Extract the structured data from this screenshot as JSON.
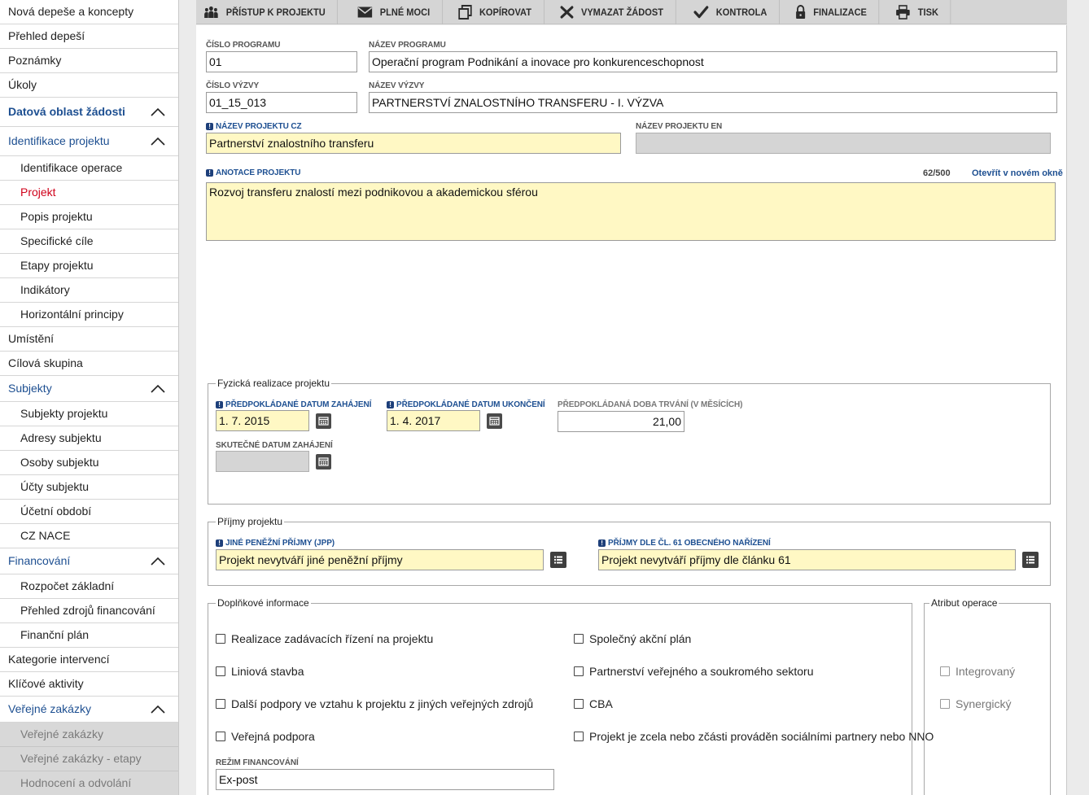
{
  "sidebar": {
    "items": [
      {
        "label": "Nová depeše a koncepty"
      },
      {
        "label": "Přehled depeší"
      },
      {
        "label": "Poznámky"
      },
      {
        "label": "Úkoly"
      },
      {
        "label": "Datová oblast žádosti"
      },
      {
        "label": "Identifikace projektu"
      },
      {
        "label": "Identifikace operace"
      },
      {
        "label": "Projekt"
      },
      {
        "label": "Popis projektu"
      },
      {
        "label": "Specifické cíle"
      },
      {
        "label": "Etapy projektu"
      },
      {
        "label": "Indikátory"
      },
      {
        "label": "Horizontální principy"
      },
      {
        "label": "Umístění"
      },
      {
        "label": "Cílová skupina"
      },
      {
        "label": "Subjekty"
      },
      {
        "label": "Subjekty projektu"
      },
      {
        "label": "Adresy subjektu"
      },
      {
        "label": "Osoby subjektu"
      },
      {
        "label": "Účty subjektu"
      },
      {
        "label": "Účetní období"
      },
      {
        "label": "CZ NACE"
      },
      {
        "label": "Financování"
      },
      {
        "label": "Rozpočet základní"
      },
      {
        "label": "Přehled zdrojů financování"
      },
      {
        "label": "Finanční plán"
      },
      {
        "label": "Kategorie intervencí"
      },
      {
        "label": "Klíčové aktivity"
      },
      {
        "label": "Veřejné zakázky"
      },
      {
        "label": "Veřejné zakázky"
      },
      {
        "label": "Veřejné zakázky - etapy"
      },
      {
        "label": "Hodnocení a odvolání"
      }
    ]
  },
  "toolbar": {
    "buttons": [
      {
        "label": "PŘÍSTUP K PROJEKTU",
        "icon": "users-icon"
      },
      {
        "label": "PLNÉ MOCI",
        "icon": "envelope-icon"
      },
      {
        "label": "KOPÍROVAT",
        "icon": "copy-icon"
      },
      {
        "label": "VYMAZAT ŽÁDOST",
        "icon": "delete-icon"
      },
      {
        "label": "KONTROLA",
        "icon": "check-icon"
      },
      {
        "label": "FINALIZACE",
        "icon": "lock-icon"
      },
      {
        "label": "TISK",
        "icon": "print-icon"
      }
    ]
  },
  "form": {
    "program_number_label": "ČÍSLO PROGRAMU",
    "program_number": "01",
    "program_name_label": "NÁZEV PROGRAMU",
    "program_name": "Operační program Podnikání a inovace pro konkurenceschopnost",
    "call_number_label": "ČÍSLO VÝZVY",
    "call_number": "01_15_013",
    "call_name_label": "NÁZEV VÝZVY",
    "call_name": "PARTNERSTVÍ ZNALOSTNÍHO TRANSFERU - I. VÝZVA",
    "project_name_cz_label": "NÁZEV PROJEKTU CZ",
    "project_name_cz": "Partnerství znalostního transferu",
    "project_name_en_label": "NÁZEV PROJEKTU EN",
    "project_name_en": "",
    "annotation_label": "ANOTACE PROJEKTU",
    "annotation_counter": "62/500",
    "annotation_link": "Otevřít v novém okně",
    "annotation": "Rozvoj transferu znalostí mezi podnikovou a akademickou sférou"
  },
  "physical": {
    "legend": "Fyzická realizace projektu",
    "start_label": "PŘEDPOKLÁDANÉ DATUM ZAHÁJENÍ",
    "start": "1. 7. 2015",
    "end_label": "PŘEDPOKLÁDANÉ DATUM UKONČENÍ",
    "end": "1. 4. 2017",
    "duration_label": "PŘEDPOKLÁDANÁ DOBA TRVÁNÍ (V MĚSÍCÍCH)",
    "duration": "21,00",
    "actual_start_label": "SKUTEČNÉ DATUM ZAHÁJENÍ",
    "actual_start": ""
  },
  "income": {
    "legend": "Příjmy projektu",
    "jpp_label": "JINÉ PENĚŽNÍ PŘÍJMY (JPP)",
    "jpp": "Projekt nevytváří jiné peněžní příjmy",
    "art61_label": "PŘÍJMY DLE ČL. 61 OBECNÉHO NAŘÍZENÍ",
    "art61": "Projekt nevytváří příjmy dle článku 61"
  },
  "additional": {
    "legend": "Doplňkové informace",
    "checks_left": [
      {
        "label": "Realizace zadávacích řízení na projektu"
      },
      {
        "label": "Liniová stavba"
      },
      {
        "label": "Další podpory ve vztahu k projektu z jiných veřejných zdrojů"
      },
      {
        "label": "Veřejná podpora"
      }
    ],
    "checks_right": [
      {
        "label": "Společný akční plán"
      },
      {
        "label": "Partnerství veřejného a soukromého sektoru"
      },
      {
        "label": "CBA"
      },
      {
        "label": "Projekt je zcela nebo zčásti prováděn sociálními partnery nebo NNO"
      }
    ],
    "financing_label": "REŽIM FINANCOVÁNÍ",
    "financing": "Ex-post"
  },
  "attribute": {
    "legend": "Atribut operace",
    "checks": [
      {
        "label": "Integrovaný"
      },
      {
        "label": "Synergický"
      }
    ]
  }
}
